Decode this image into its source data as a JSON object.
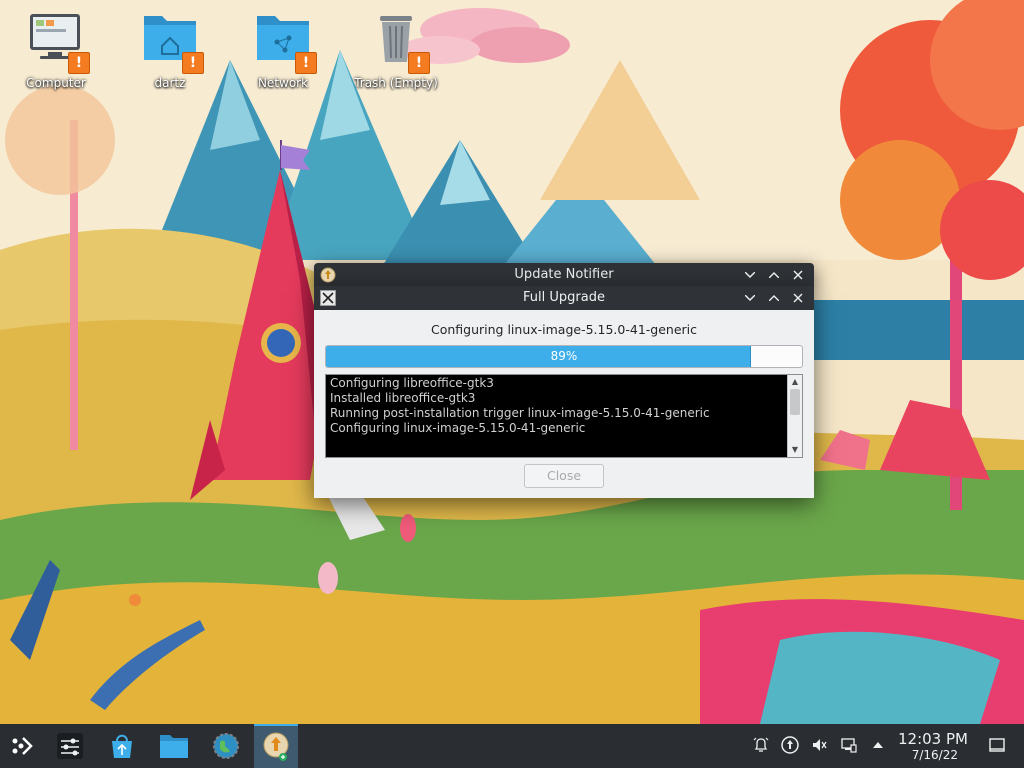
{
  "desktop": {
    "icons": [
      {
        "label": "Computer",
        "icon": "computer-icon"
      },
      {
        "label": "dartz",
        "icon": "home-folder-icon"
      },
      {
        "label": "Network",
        "icon": "network-folder-icon"
      },
      {
        "label": "Trash (Empty)",
        "icon": "trash-icon"
      }
    ],
    "badge_symbol": "!"
  },
  "update_notifier": {
    "title": "Update Notifier"
  },
  "upgrade_window": {
    "title": "Full Upgrade",
    "status": "Configuring linux-image-5.15.0-41-generic",
    "progress_value": 89,
    "progress_label": "89%",
    "log_lines": [
      "Configuring libreoffice-gtk3",
      "Installed libreoffice-gtk3",
      "Running post-installation trigger linux-image-5.15.0-41-generic",
      "Configuring linux-image-5.15.0-41-generic"
    ],
    "close_label": "Close",
    "close_enabled": false
  },
  "taskbar": {
    "items": [
      "application-launcher-icon",
      "system-settings-icon",
      "discover-store-icon",
      "dolphin-file-manager-icon",
      "web-browser-icon",
      "update-notifier-icon"
    ],
    "tray": [
      "notifications-icon",
      "updates-icon",
      "volume-muted-icon",
      "network-icon",
      "expand-tray-icon"
    ],
    "clock_time": "12:03 PM",
    "clock_date": "7/16/22"
  },
  "colors": {
    "accent": "#3daee9",
    "panel": "#2a2e32",
    "titlebar": "#2f3337",
    "badge": "#f47b20"
  }
}
